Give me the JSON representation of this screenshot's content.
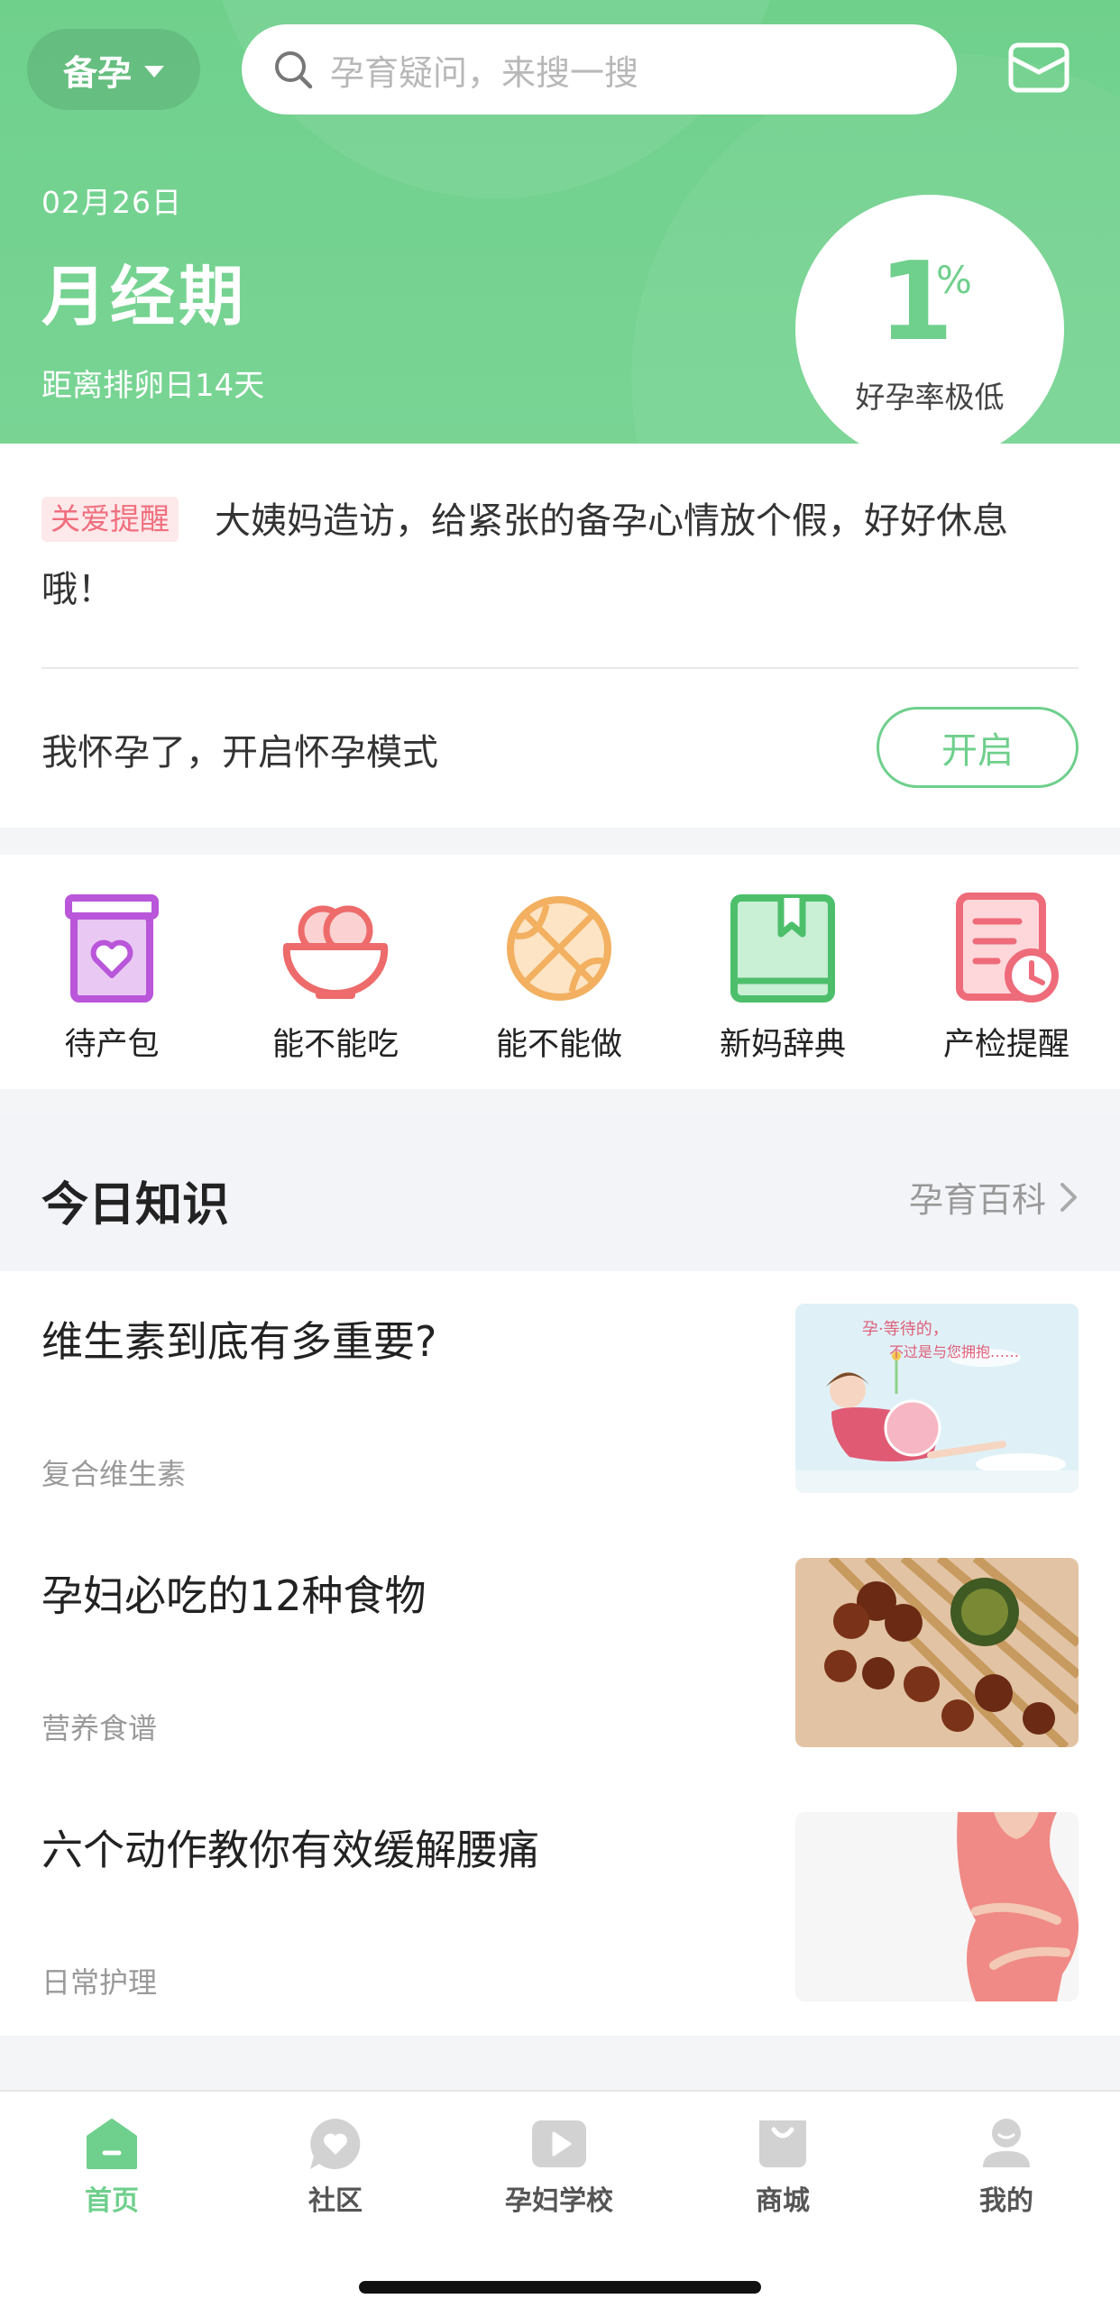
{
  "header": {
    "stage_label": "备孕",
    "search_placeholder": "孕育疑问，来搜一搜",
    "date": "02月26日",
    "phase": "月经期",
    "countdown": "距离排卵日14天",
    "rate_value": "1",
    "rate_unit": "%",
    "rate_label": "好孕率极低",
    "brand_color": "#6fcf8c"
  },
  "reminder": {
    "tag": "关爱提醒",
    "text": "大姨妈造访，给紧张的备孕心情放个假，好好休息哦！",
    "pregnant_prompt": "我怀孕了，开启怀孕模式",
    "open_button": "开启"
  },
  "tools": [
    {
      "label": "待产包",
      "icon": "hospital-bag-icon"
    },
    {
      "label": "能不能吃",
      "icon": "food-bowl-icon"
    },
    {
      "label": "能不能做",
      "icon": "ball-icon"
    },
    {
      "label": "新妈辞典",
      "icon": "dictionary-book-icon"
    },
    {
      "label": "产检提醒",
      "icon": "checkup-clock-icon"
    }
  ],
  "knowledge": {
    "title": "今日知识",
    "more": "孕育百科",
    "articles": [
      {
        "title": "维生素到底有多重要?",
        "category": "复合维生素",
        "thumb_text_1": "孕·等待的，",
        "thumb_text_2": "不过是与您拥抱……"
      },
      {
        "title": "孕妇必吃的12种食物",
        "category": "营养食谱"
      },
      {
        "title": "六个动作教你有效缓解腰痛",
        "category": "日常护理"
      }
    ]
  },
  "tabbar": {
    "items": [
      {
        "label": "首页",
        "active": true
      },
      {
        "label": "社区",
        "active": false
      },
      {
        "label": "孕妇学校",
        "active": false
      },
      {
        "label": "商城",
        "active": false
      },
      {
        "label": "我的",
        "active": false
      }
    ]
  }
}
